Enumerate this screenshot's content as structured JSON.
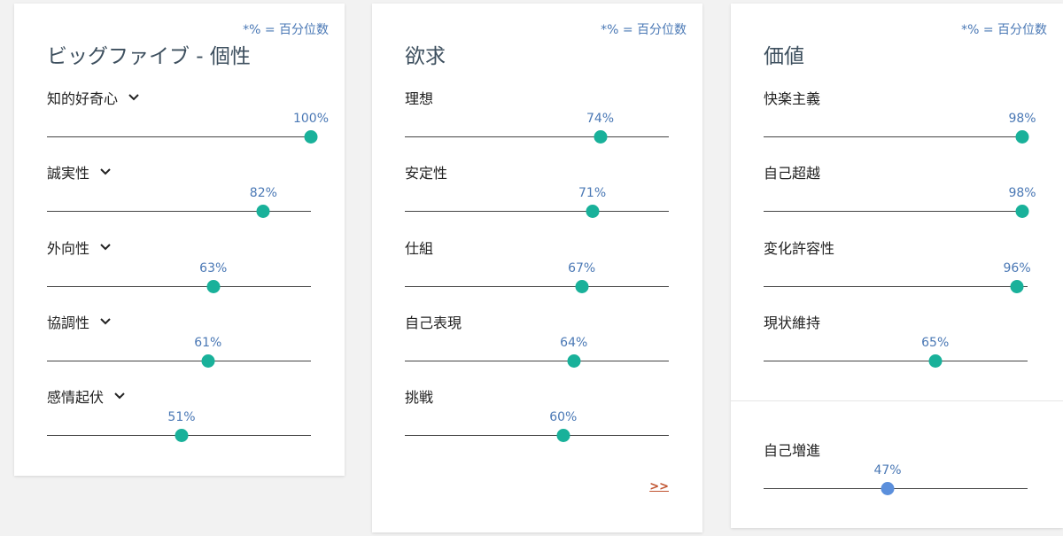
{
  "percent_note": "*% = 百分位数",
  "big_five": {
    "title": "ビッグファイブ - 個性",
    "traits": [
      {
        "label": "知的好奇心",
        "percent_text": "100%",
        "value": 100
      },
      {
        "label": "誠実性",
        "percent_text": "82%",
        "value": 82
      },
      {
        "label": "外向性",
        "percent_text": "63%",
        "value": 63
      },
      {
        "label": "協調性",
        "percent_text": "61%",
        "value": 61
      },
      {
        "label": "感情起伏",
        "percent_text": "51%",
        "value": 51
      }
    ]
  },
  "needs": {
    "title": "欲求",
    "traits": [
      {
        "label": "理想",
        "percent_text": "74%",
        "value": 74
      },
      {
        "label": "安定性",
        "percent_text": "71%",
        "value": 71
      },
      {
        "label": "仕組",
        "percent_text": "67%",
        "value": 67
      },
      {
        "label": "自己表現",
        "percent_text": "64%",
        "value": 64
      },
      {
        "label": "挑戦",
        "percent_text": "60%",
        "value": 60
      }
    ],
    "more_link": ">>"
  },
  "values": {
    "title": "価値",
    "traits": [
      {
        "label": "快楽主義",
        "percent_text": "98%",
        "value": 98
      },
      {
        "label": "自己超越",
        "percent_text": "98%",
        "value": 98
      },
      {
        "label": "変化許容性",
        "percent_text": "96%",
        "value": 96
      },
      {
        "label": "現状維持",
        "percent_text": "65%",
        "value": 65
      },
      {
        "label": "自己増進",
        "percent_text": "47%",
        "value": 47
      }
    ]
  },
  "colors": {
    "dot_primary": "#19b19a",
    "dot_secondary": "#5b8fdc",
    "percent_text": "#4a78b5",
    "link": "#c0522e"
  }
}
